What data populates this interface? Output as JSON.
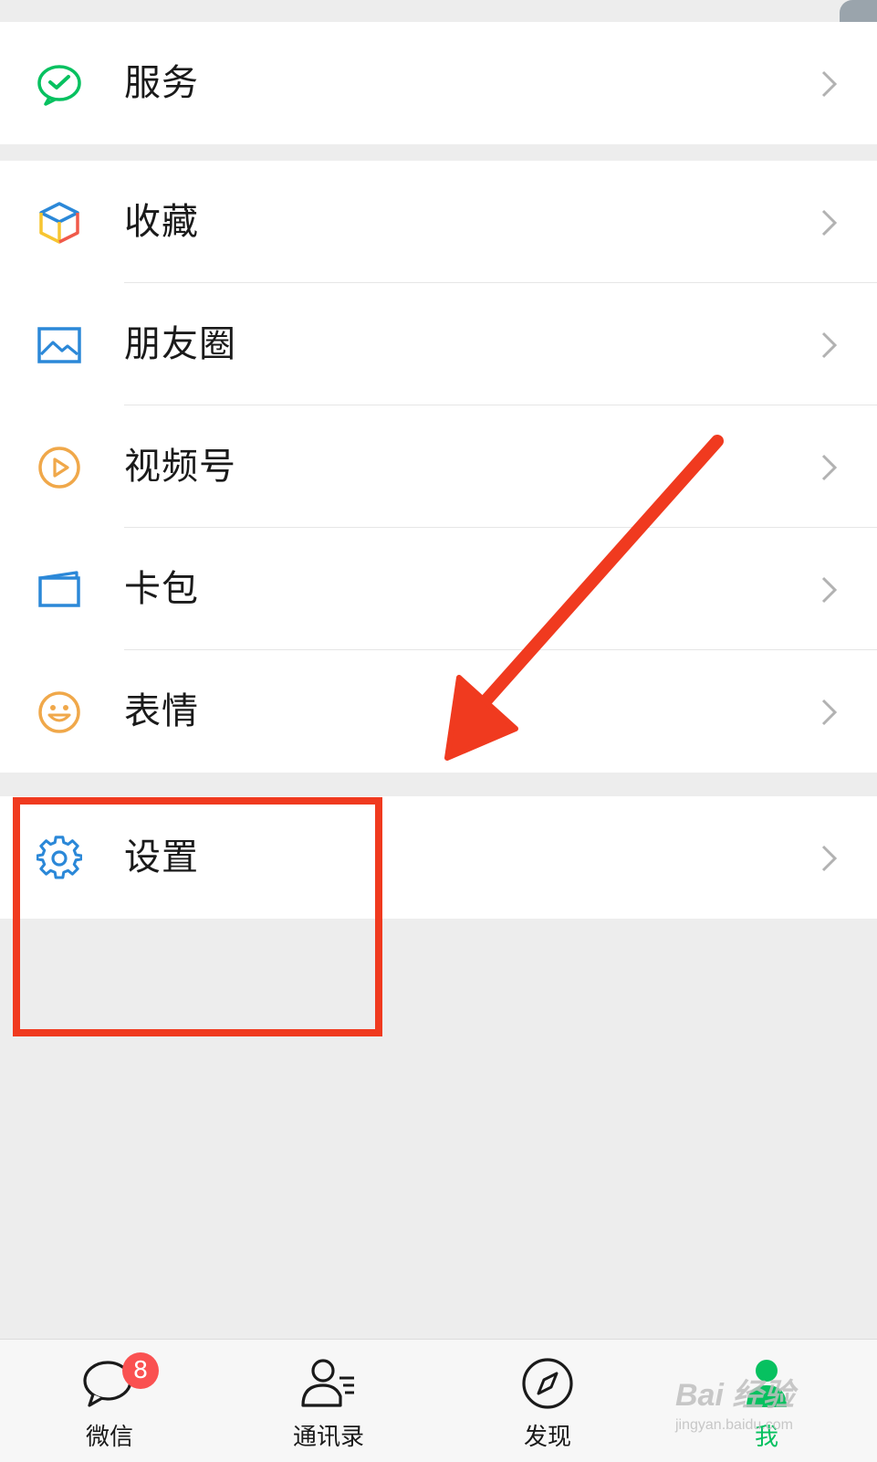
{
  "menu": {
    "service": {
      "label": "服务"
    },
    "favorites": {
      "label": "收藏"
    },
    "moments": {
      "label": "朋友圈"
    },
    "channels": {
      "label": "视频号"
    },
    "cards": {
      "label": "卡包"
    },
    "stickers": {
      "label": "表情"
    },
    "settings": {
      "label": "设置"
    }
  },
  "tabbar": {
    "chats": {
      "label": "微信",
      "badge": "8"
    },
    "contacts": {
      "label": "通讯录"
    },
    "discover": {
      "label": "发现"
    },
    "me": {
      "label": "我"
    }
  },
  "watermark": {
    "brand": "Bai 经验",
    "url": "jingyan.baidu.com"
  },
  "colors": {
    "accent": "#07c160",
    "annotation": "#f03a1f",
    "badge": "#fa5151"
  }
}
